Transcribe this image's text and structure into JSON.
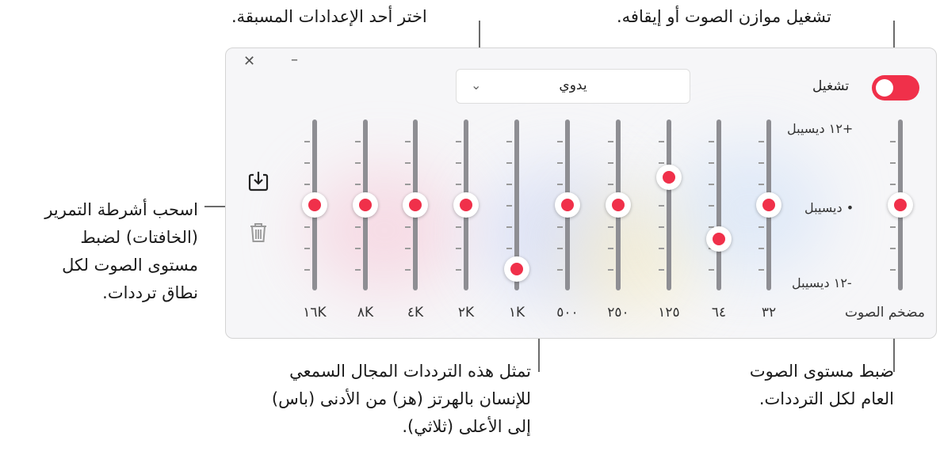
{
  "callouts": {
    "toggle": "تشغيل موازن الصوت أو إيقافه.",
    "preset": "اختر أحد الإعدادات المسبقة.",
    "sliders": [
      "اسحب أشرطة التمرير",
      "(الخافتات) لضبط",
      "مستوى الصوت لكل",
      "نطاق ترددات."
    ],
    "frequencies": [
      "تمثل هذه الترددات المجال السمعي",
      "للإنسان بالهرتز (هز) من الأدنى (باس)",
      "إلى الأعلى (ثلاثي)."
    ],
    "preamp": [
      "ضبط مستوى الصوت",
      "العام لكل الترددات."
    ]
  },
  "window": {
    "close_icon": "close-icon",
    "minimize_icon": "minimize-icon"
  },
  "preset": {
    "value": "يدوي",
    "icon": "chevron-down-icon"
  },
  "toggle": {
    "label": "تشغيل",
    "on": true
  },
  "actions": {
    "save_icon": "save-download-icon",
    "delete_icon": "trash-icon"
  },
  "db_labels": {
    "top": "+١٢ ديسيبل",
    "mid": "• ديسيبل",
    "bottom": "-١٢ ديسيبل"
  },
  "preamp": {
    "label": "مضخم الصوت",
    "value_db": 0
  },
  "bands": [
    {
      "label": "٣٢",
      "value_db": 0
    },
    {
      "label": "٦٤",
      "value_db": -5.5
    },
    {
      "label": "١٢٥",
      "value_db": 4.5
    },
    {
      "label": "٢٥٠",
      "value_db": 0
    },
    {
      "label": "٥٠٠",
      "value_db": 0
    },
    {
      "label": "١K",
      "value_db": -10.5
    },
    {
      "label": "٢K",
      "value_db": 0
    },
    {
      "label": "٤K",
      "value_db": 0
    },
    {
      "label": "٨K",
      "value_db": 0
    },
    {
      "label": "١٦K",
      "value_db": 0
    }
  ],
  "colors": {
    "accent": "#f0304a",
    "track": "#8e8e93"
  }
}
